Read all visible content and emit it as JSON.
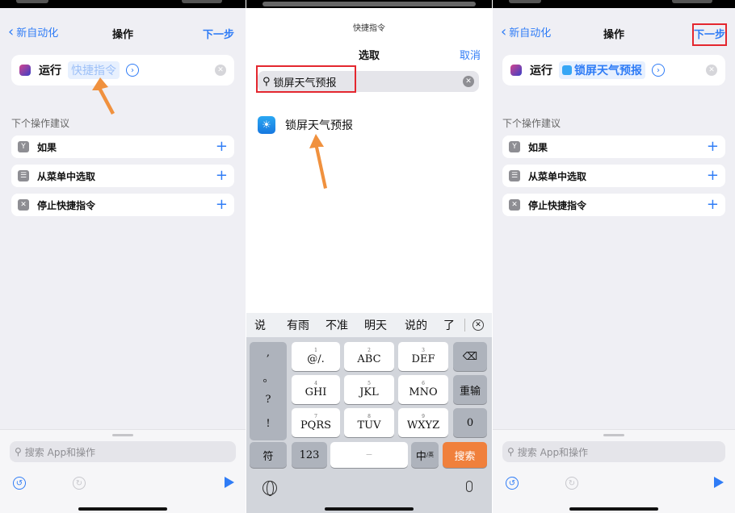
{
  "colors": {
    "accent": "#2f7cf6",
    "highlight_box": "#e4272f",
    "arrow": "#f0913e",
    "search_key": "#f0803c"
  },
  "panel1": {
    "nav": {
      "back": "新自动化",
      "title": "操作",
      "next": "下一步"
    },
    "run": {
      "label": "运行",
      "placeholder": "快捷指令"
    },
    "section_title": "下个操作建议",
    "suggestions": [
      {
        "label": "如果",
        "icon": "branch-icon"
      },
      {
        "label": "从菜单中选取",
        "icon": "menu-icon"
      },
      {
        "label": "停止快捷指令",
        "icon": "stop-icon"
      }
    ],
    "search_placeholder": "搜索 App和操作"
  },
  "panel2": {
    "header_small": "快捷指令",
    "title": "选取",
    "cancel": "取消",
    "search_value": "锁屏天气预报",
    "result": "锁屏天气预报",
    "candidates": [
      "说",
      "有雨",
      "不准",
      "明天",
      "说的",
      "了"
    ],
    "keys": {
      "punct": [
        ",",
        "。",
        "?",
        "!"
      ],
      "row1": [
        {
          "n": "1",
          "l": "@/."
        },
        {
          "n": "2",
          "l": "ABC"
        },
        {
          "n": "3",
          "l": "DEF"
        }
      ],
      "row2": [
        {
          "n": "4",
          "l": "GHI"
        },
        {
          "n": "5",
          "l": "JKL"
        },
        {
          "n": "6",
          "l": "MNO"
        }
      ],
      "row3": [
        {
          "n": "7",
          "l": "PQRS"
        },
        {
          "n": "8",
          "l": "TUV"
        },
        {
          "n": "9",
          "l": "WXYZ"
        }
      ],
      "enter": "重输",
      "zero": "0",
      "symbol": "符",
      "numbers": "123",
      "lang": "中",
      "lang_sub": "/英",
      "search": "搜索"
    }
  },
  "panel3": {
    "nav": {
      "back": "新自动化",
      "title": "操作",
      "next": "下一步"
    },
    "run": {
      "label": "运行",
      "value": "锁屏天气预报"
    },
    "section_title": "下个操作建议",
    "suggestions": [
      {
        "label": "如果",
        "icon": "branch-icon"
      },
      {
        "label": "从菜单中选取",
        "icon": "menu-icon"
      },
      {
        "label": "停止快捷指令",
        "icon": "stop-icon"
      }
    ],
    "search_placeholder": "搜索 App和操作"
  }
}
